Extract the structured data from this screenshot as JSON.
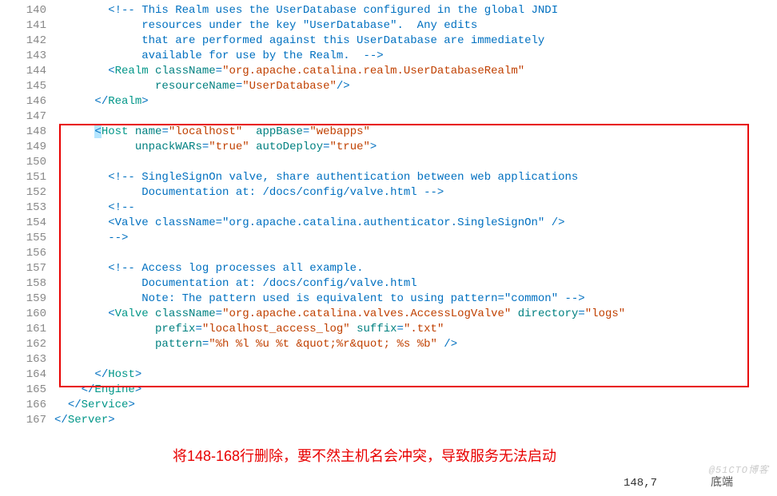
{
  "annotation": "将148-168行删除，要不然主机名会冲突，导致服务无法启动",
  "status": {
    "pos": "148,7",
    "right": "底端"
  },
  "watermark": "@51CTO博客",
  "lines": [
    {
      "n": 140,
      "segs": [
        {
          "t": "        ",
          "c": ""
        },
        {
          "t": "<!-- This Realm uses the UserDatabase configured in the global JNDI",
          "c": "cmt"
        }
      ]
    },
    {
      "n": 141,
      "segs": [
        {
          "t": "             resources under the key \"UserDatabase\".  Any edits",
          "c": "cmt"
        }
      ]
    },
    {
      "n": 142,
      "segs": [
        {
          "t": "             that are performed against this UserDatabase are immediately",
          "c": "cmt"
        }
      ]
    },
    {
      "n": 143,
      "segs": [
        {
          "t": "             available for use by the Realm.  -->",
          "c": "cmt"
        }
      ]
    },
    {
      "n": 144,
      "segs": [
        {
          "t": "        ",
          "c": ""
        },
        {
          "t": "<",
          "c": "punct"
        },
        {
          "t": "Realm",
          "c": "tag"
        },
        {
          "t": " ",
          "c": ""
        },
        {
          "t": "className",
          "c": "attr"
        },
        {
          "t": "=",
          "c": "punct"
        },
        {
          "t": "\"org.apache.catalina.realm.UserDatabaseRealm\"",
          "c": "str"
        }
      ]
    },
    {
      "n": 145,
      "segs": [
        {
          "t": "               ",
          "c": ""
        },
        {
          "t": "resourceName",
          "c": "attr"
        },
        {
          "t": "=",
          "c": "punct"
        },
        {
          "t": "\"UserDatabase\"",
          "c": "str"
        },
        {
          "t": "/>",
          "c": "punct"
        }
      ]
    },
    {
      "n": 146,
      "segs": [
        {
          "t": "      ",
          "c": ""
        },
        {
          "t": "</",
          "c": "punct"
        },
        {
          "t": "Realm",
          "c": "tag"
        },
        {
          "t": ">",
          "c": "punct"
        }
      ]
    },
    {
      "n": 147,
      "segs": [
        {
          "t": "",
          "c": ""
        }
      ]
    },
    {
      "n": 148,
      "segs": [
        {
          "t": "      ",
          "c": ""
        },
        {
          "t": "<",
          "c": "cursor-hl punct"
        },
        {
          "t": "Host",
          "c": "tag"
        },
        {
          "t": " ",
          "c": ""
        },
        {
          "t": "name",
          "c": "attr"
        },
        {
          "t": "=",
          "c": "punct"
        },
        {
          "t": "\"localhost\"",
          "c": "str"
        },
        {
          "t": "  ",
          "c": ""
        },
        {
          "t": "appBase",
          "c": "attr"
        },
        {
          "t": "=",
          "c": "punct"
        },
        {
          "t": "\"webapps\"",
          "c": "str"
        }
      ]
    },
    {
      "n": 149,
      "segs": [
        {
          "t": "            ",
          "c": ""
        },
        {
          "t": "unpackWARs",
          "c": "attr"
        },
        {
          "t": "=",
          "c": "punct"
        },
        {
          "t": "\"true\"",
          "c": "str"
        },
        {
          "t": " ",
          "c": ""
        },
        {
          "t": "autoDeploy",
          "c": "attr"
        },
        {
          "t": "=",
          "c": "punct"
        },
        {
          "t": "\"true\"",
          "c": "str"
        },
        {
          "t": ">",
          "c": "punct"
        }
      ]
    },
    {
      "n": 150,
      "segs": [
        {
          "t": "",
          "c": ""
        }
      ]
    },
    {
      "n": 151,
      "segs": [
        {
          "t": "        ",
          "c": ""
        },
        {
          "t": "<!-- SingleSignOn valve, share authentication between web applications",
          "c": "cmt"
        }
      ]
    },
    {
      "n": 152,
      "segs": [
        {
          "t": "             Documentation at: /docs/config/valve.html -->",
          "c": "cmt"
        }
      ]
    },
    {
      "n": 153,
      "segs": [
        {
          "t": "        ",
          "c": ""
        },
        {
          "t": "<!--",
          "c": "cmt"
        }
      ]
    },
    {
      "n": 154,
      "segs": [
        {
          "t": "        <Valve className=\"org.apache.catalina.authenticator.SingleSignOn\" />",
          "c": "cmt"
        }
      ]
    },
    {
      "n": 155,
      "segs": [
        {
          "t": "        -->",
          "c": "cmt"
        }
      ]
    },
    {
      "n": 156,
      "segs": [
        {
          "t": "",
          "c": ""
        }
      ]
    },
    {
      "n": 157,
      "segs": [
        {
          "t": "        ",
          "c": ""
        },
        {
          "t": "<!-- Access log processes all example.",
          "c": "cmt"
        }
      ]
    },
    {
      "n": 158,
      "segs": [
        {
          "t": "             Documentation at: /docs/config/valve.html",
          "c": "cmt"
        }
      ]
    },
    {
      "n": 159,
      "segs": [
        {
          "t": "             Note: The pattern used is equivalent to using pattern=\"common\" -->",
          "c": "cmt"
        }
      ]
    },
    {
      "n": 160,
      "segs": [
        {
          "t": "        ",
          "c": ""
        },
        {
          "t": "<",
          "c": "punct"
        },
        {
          "t": "Valve",
          "c": "tag"
        },
        {
          "t": " ",
          "c": ""
        },
        {
          "t": "className",
          "c": "attr"
        },
        {
          "t": "=",
          "c": "punct"
        },
        {
          "t": "\"org.apache.catalina.valves.AccessLogValve\"",
          "c": "str"
        },
        {
          "t": " ",
          "c": ""
        },
        {
          "t": "directory",
          "c": "attr"
        },
        {
          "t": "=",
          "c": "punct"
        },
        {
          "t": "\"logs\"",
          "c": "str"
        }
      ]
    },
    {
      "n": 161,
      "segs": [
        {
          "t": "               ",
          "c": ""
        },
        {
          "t": "prefix",
          "c": "attr"
        },
        {
          "t": "=",
          "c": "punct"
        },
        {
          "t": "\"localhost_access_log\"",
          "c": "str"
        },
        {
          "t": " ",
          "c": ""
        },
        {
          "t": "suffix",
          "c": "attr"
        },
        {
          "t": "=",
          "c": "punct"
        },
        {
          "t": "\".txt\"",
          "c": "str"
        }
      ]
    },
    {
      "n": 162,
      "segs": [
        {
          "t": "               ",
          "c": ""
        },
        {
          "t": "pattern",
          "c": "attr"
        },
        {
          "t": "=",
          "c": "punct"
        },
        {
          "t": "\"%h %l %u %t &quot;%r&quot; %s %b\"",
          "c": "str"
        },
        {
          "t": " />",
          "c": "punct"
        }
      ]
    },
    {
      "n": 163,
      "segs": [
        {
          "t": "",
          "c": ""
        }
      ]
    },
    {
      "n": 164,
      "segs": [
        {
          "t": "      ",
          "c": ""
        },
        {
          "t": "</",
          "c": "punct"
        },
        {
          "t": "Host",
          "c": "tag"
        },
        {
          "t": ">",
          "c": "punct"
        }
      ]
    },
    {
      "n": 165,
      "segs": [
        {
          "t": "    ",
          "c": ""
        },
        {
          "t": "</",
          "c": "punct"
        },
        {
          "t": "Engine",
          "c": "tag"
        },
        {
          "t": ">",
          "c": "punct"
        }
      ]
    },
    {
      "n": 166,
      "segs": [
        {
          "t": "  ",
          "c": ""
        },
        {
          "t": "</",
          "c": "punct"
        },
        {
          "t": "Service",
          "c": "tag"
        },
        {
          "t": ">",
          "c": "punct"
        }
      ]
    },
    {
      "n": 167,
      "segs": [
        {
          "t": "",
          "c": ""
        },
        {
          "t": "</",
          "c": "punct"
        },
        {
          "t": "Server",
          "c": "tag"
        },
        {
          "t": ">",
          "c": "punct"
        }
      ]
    }
  ]
}
